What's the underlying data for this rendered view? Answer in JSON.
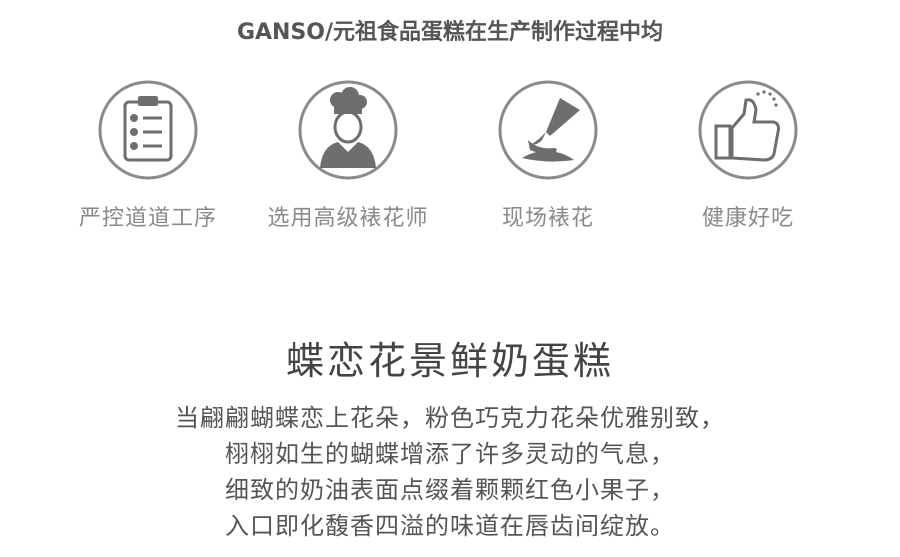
{
  "headline": "GANSO/元祖食品蛋糕在生产制作过程中均",
  "features": [
    {
      "icon": "clipboard-checklist-icon",
      "label": "严控道道工序"
    },
    {
      "icon": "chef-icon",
      "label": "选用高级裱花师"
    },
    {
      "icon": "piping-bag-icon",
      "label": "现场裱花"
    },
    {
      "icon": "thumbs-up-icon",
      "label": "健康好吃"
    }
  ],
  "product": {
    "title": "蝶恋花景鲜奶蛋糕",
    "description_lines": [
      "当翩翩蝴蝶恋上花朵，粉色巧克力花朵优雅别致，",
      "栩栩如生的蝴蝶增添了许多灵动的气息，",
      "细致的奶油表面点缀着颗颗红色小果子，",
      "入口即化馥香四溢的味道在唇齿间绽放。"
    ]
  },
  "colors": {
    "icon_gray": "#8a8a8a",
    "icon_dark": "#6e6e6e",
    "text_dark": "#444444"
  }
}
